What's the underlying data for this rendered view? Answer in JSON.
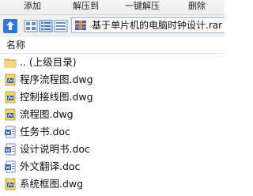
{
  "toolbar": {
    "add_label": "添加",
    "extract_to_label": "解压到",
    "one_click_extract_label": "一键解压",
    "delete_label": "删除"
  },
  "address": {
    "path_text": "基于单片机的电脑时钟设计.rar"
  },
  "columns": {
    "name_header": "名称"
  },
  "files": [
    {
      "name": ".. (上级目录)",
      "icon": "parent-folder-icon"
    },
    {
      "name": "程序流程图.dwg",
      "icon": "dwg-file-icon"
    },
    {
      "name": "控制接线图.dwg",
      "icon": "dwg-file-icon"
    },
    {
      "name": "流程图.dwg",
      "icon": "dwg-file-icon"
    },
    {
      "name": "任务书.doc",
      "icon": "doc-file-icon"
    },
    {
      "name": "设计说明书.doc",
      "icon": "doc-file-icon"
    },
    {
      "name": "外文翻译.doc",
      "icon": "doc-file-icon"
    },
    {
      "name": "系统框图.dwg",
      "icon": "dwg-file-icon"
    }
  ],
  "colors": {
    "address_border": "#9bb5d6",
    "toolbar_bg": "#f0f0f0",
    "folder_yellow": "#e8c257",
    "doc_blue": "#3a62b8"
  }
}
